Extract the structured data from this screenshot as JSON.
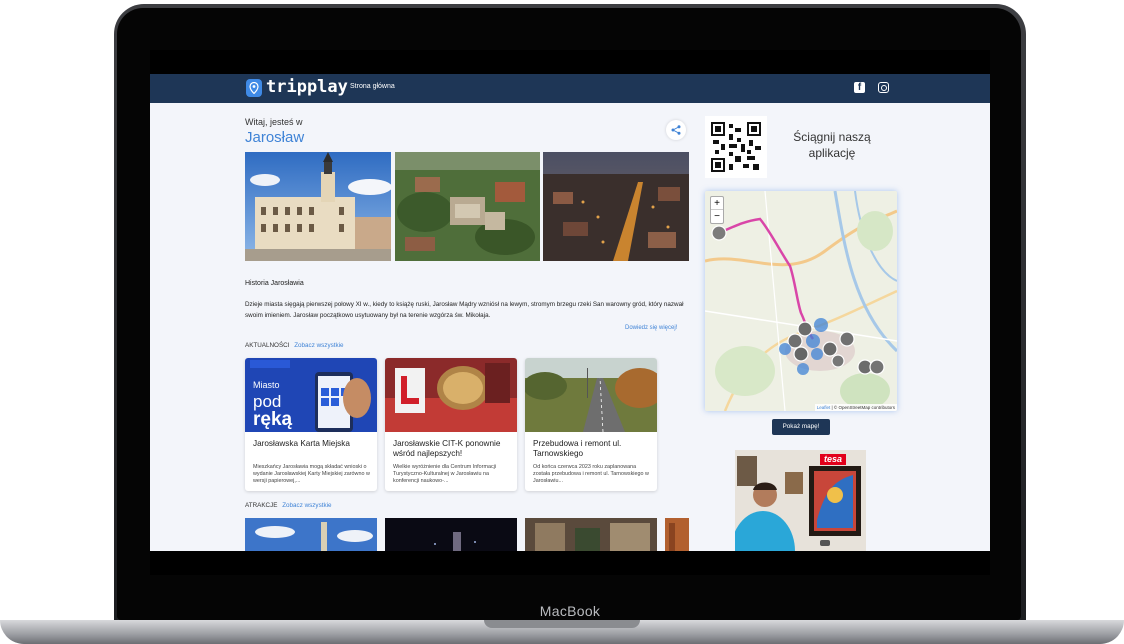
{
  "device": {
    "brand": "MacBook"
  },
  "header": {
    "logo_text": "tripplay",
    "nav_home": "Strona główna",
    "icons": [
      "facebook-icon",
      "instagram-icon"
    ]
  },
  "intro": {
    "welcome": "Witaj, jesteś w",
    "city": "Jarosław"
  },
  "history": {
    "title": "Historia Jarosławia",
    "text": "Dzieje miasta sięgają pierwszej połowy XI w., kiedy to książę ruski, Jarosław Mądry wzniósł na lewym, stromym brzegu rzeki San warowny gród, który nazwał swoim imieniem. Jarosław początkowo usytuowany był na terenie wzgórza św. Mikołaja.",
    "more_link": "Dowiedz się więcej!"
  },
  "news": {
    "label": "AKTUALNOŚCI",
    "see_all": "Zobacz wszystkie",
    "items": [
      {
        "title": "Jarosławska Karta Miejska",
        "desc": "Mieszkańcy Jarosławia mogą składać wnioski o wydanie Jarosławskiej Karty Miejskiej zarówno w wersji papierowej,...",
        "img_text_1": "Miasto",
        "img_text_2": "pod",
        "img_text_3": "ręką"
      },
      {
        "title": "Jarosławskie CIT-K ponownie wśród najlepszych!",
        "desc": "Wielkie wyróżnienie dla Centrum Informacji Turystyczno-Kulturalnej w Jarosławiu na konferencji naukowo-..."
      },
      {
        "title": "Przebudowa i remont ul. Tarnowskiego",
        "desc": "Od końca czerwca 2023 roku zaplanowana została przebudowa i remont ul. Tarnowskiego w Jarosławiu..."
      }
    ]
  },
  "attractions": {
    "label": "ATRAKCJE",
    "see_all": "Zobacz wszystkie"
  },
  "app_promo": {
    "text": "Ściągnij naszą aplikację"
  },
  "map": {
    "zoom_in": "+",
    "zoom_out": "−",
    "attribution_leaflet": "Leaflet",
    "attribution_osm": "| © OpenStreetMap contributors",
    "button": "Pokaż mapę!"
  },
  "ad": {
    "brand": "tesa"
  },
  "colors": {
    "navbar": "#1e3656",
    "accent": "#3f83d6",
    "page_bg": "#f3f5fa",
    "route": "#d946a8"
  }
}
